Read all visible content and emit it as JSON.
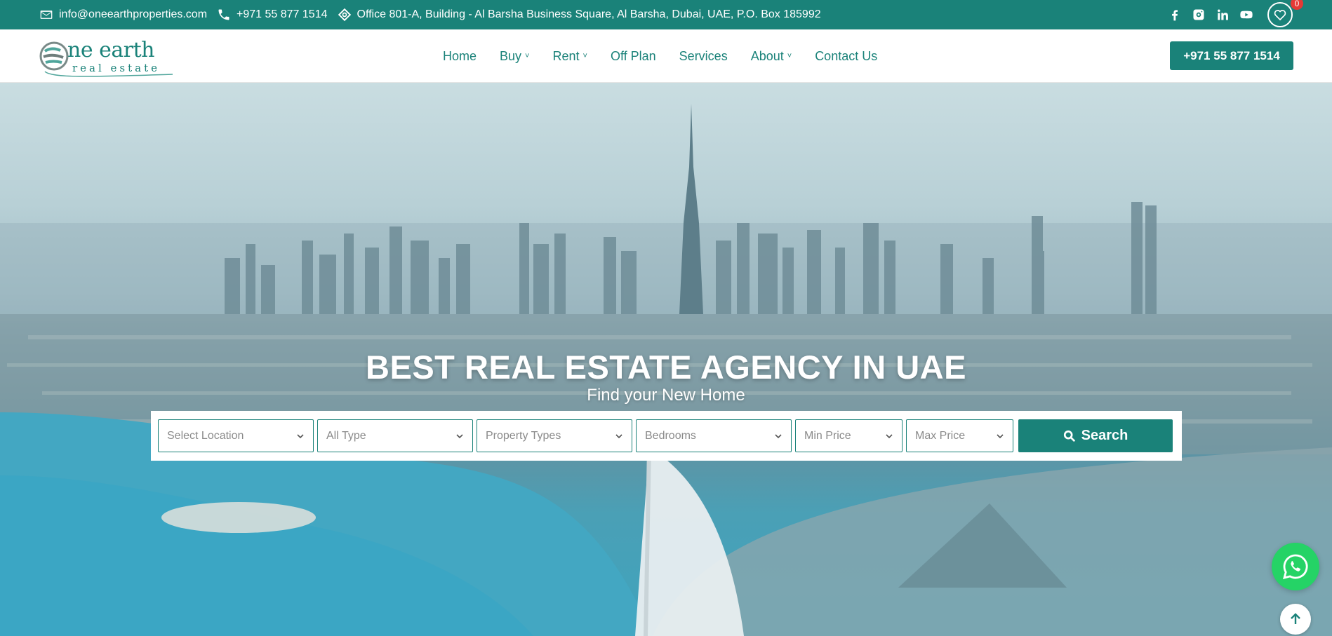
{
  "colors": {
    "brand": "#1a8279",
    "white": "#ffffff",
    "badge": "#e53935",
    "whatsapp": "#25d366"
  },
  "topbar": {
    "email": "info@oneearthproperties.com",
    "phone": "+971 55 877 1514",
    "address": "Office 801-A, Building - Al Barsha Business Square, Al Barsha, Dubai, UAE, P.O. Box 185992",
    "icons": [
      "mail-icon",
      "phone-icon",
      "location-icon"
    ],
    "socials": [
      "facebook-icon",
      "instagram-icon",
      "linkedin-icon",
      "youtube-icon"
    ],
    "wishlist_count": "0"
  },
  "logo": {
    "line1": "ne earth",
    "line2": "real estate"
  },
  "nav": {
    "items": [
      {
        "label": "Home",
        "dropdown": false
      },
      {
        "label": "Buy",
        "dropdown": true
      },
      {
        "label": "Rent",
        "dropdown": true
      },
      {
        "label": "Off Plan",
        "dropdown": false
      },
      {
        "label": "Services",
        "dropdown": false
      },
      {
        "label": "About",
        "dropdown": true
      },
      {
        "label": "Contact Us",
        "dropdown": false
      }
    ],
    "caret": "˅",
    "call_label": "+971 55 877 1514"
  },
  "hero": {
    "title": "BEST REAL ESTATE AGENCY IN UAE",
    "subtitle": "Find your New Home"
  },
  "search": {
    "fields": [
      {
        "label": "Select Location"
      },
      {
        "label": "All Type"
      },
      {
        "label": "Property Types"
      },
      {
        "label": "Bedrooms"
      },
      {
        "label": "Min Price"
      },
      {
        "label": "Max Price"
      }
    ],
    "button_label": "Search"
  }
}
